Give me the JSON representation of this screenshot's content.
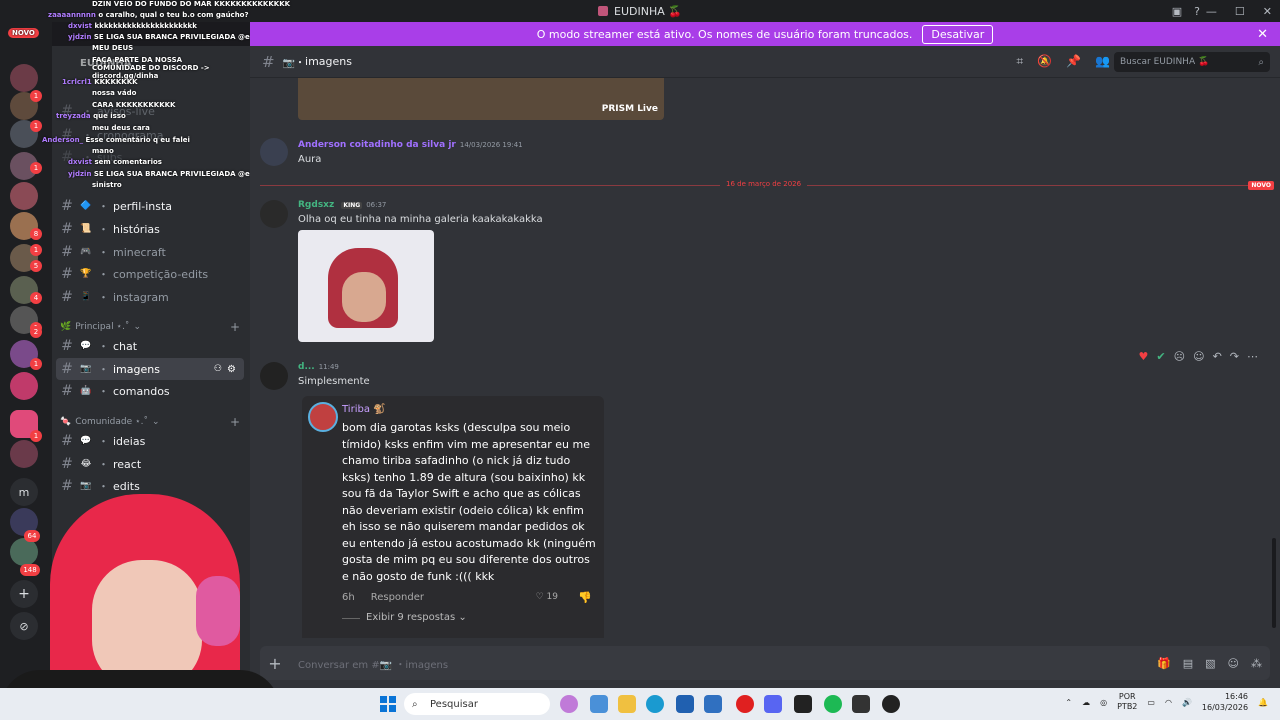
{
  "titlebar": {
    "title": "EUDINHA 🍒"
  },
  "banner": {
    "text": "O modo streamer está ativo. Os nomes de usuário foram truncados.",
    "button": "Desativar"
  },
  "overlay": {
    "novo": "NOVO",
    "lines": [
      {
        "name": "",
        "text": "DZIN VEIO DO FUNDO DO MAR KKKKKKKKKKKKKK"
      },
      {
        "name": "zaaaannnnn",
        "text": "o caralho, qual o teu b.o com gaúcho?"
      },
      {
        "name": "dxvist",
        "text": "kkkkkkkkkkkkkkkkkkkkkk"
      },
      {
        "name": "yjdzin",
        "text": "SE LIGA SUA BRANCA PRIVILEGIADA @eudinha_"
      },
      {
        "name": "",
        "text": "MEU DEUS"
      },
      {
        "name": "",
        "text": "FAÇA PARTE DA NOSSA COMUNIDADE DO DISCORD -> discord.gg/dinha"
      },
      {
        "name": "1crlcrl1",
        "text": "KKKKKKKK"
      },
      {
        "name": "",
        "text": "nossa vádo"
      },
      {
        "name": "",
        "text": "CARA KKKKKKKKKKK"
      },
      {
        "name": "treyzada",
        "text": "que isso"
      },
      {
        "name": "",
        "text": "meu deus cara"
      },
      {
        "name": "Anderson_",
        "text": "Esse comentário q eu falei"
      },
      {
        "name": "",
        "text": "mano"
      },
      {
        "name": "dxvist",
        "text": "sem comentarios"
      },
      {
        "name": "yjdzin",
        "text": "SE LIGA SUA BRANCA PRIVILEGIADA @eudinha_"
      },
      {
        "name": "",
        "text": "sinistro"
      }
    ]
  },
  "sidebar": {
    "server_name": "EUDINHA",
    "faded_channels": [
      "avisos-live",
      "cronograma",
      "subs"
    ],
    "channels_top": [
      {
        "emoji": "🔷",
        "name": "perfil-insta",
        "bright": true
      },
      {
        "emoji": "📜",
        "name": "histórias",
        "bright": true
      },
      {
        "emoji": "🎮",
        "name": "minecraft",
        "bright": false
      },
      {
        "emoji": "🏆",
        "name": "competição-edits",
        "bright": false
      },
      {
        "emoji": "📱",
        "name": "instagram",
        "bright": false
      }
    ],
    "cat_principal": "Principal ⋆.˚",
    "channels_principal": [
      {
        "emoji": "💬",
        "name": "chat",
        "bright": true
      },
      {
        "emoji": "📷",
        "name": "imagens",
        "bright": true,
        "active": true
      },
      {
        "emoji": "🤖",
        "name": "comandos",
        "bright": true
      }
    ],
    "cat_comunidade": "Comunidade ⋆.˚",
    "channels_comunidade": [
      {
        "emoji": "💬",
        "name": "ideias",
        "bright": true
      },
      {
        "emoji": "😂",
        "name": "react",
        "bright": true
      },
      {
        "emoji": "📷",
        "name": "edits",
        "bright": true
      }
    ]
  },
  "servers": {
    "badges": [
      "1",
      "1",
      "1",
      "8",
      "1",
      "5",
      "4",
      "1",
      "2",
      "1",
      "1",
      "64",
      "148"
    ],
    "letter": "m"
  },
  "header": {
    "channel": "imagens",
    "search_placeholder": "Buscar EUDINHA 🍒"
  },
  "messages": {
    "embed_label": "PRISM Live",
    "m1": {
      "author": "Anderson coitadinho da silva jr",
      "time": "14/03/2026 19:41",
      "text": "Aura"
    },
    "divider": {
      "label": "16 de março de 2026",
      "tag": "NOVO"
    },
    "m2": {
      "author": "Rgdsxz",
      "badge": "KING",
      "time": "06:37",
      "text": "Olha oq eu tinha na minha galeria kaakakakakka"
    },
    "m3": {
      "author": "d...",
      "time": "11:49",
      "text": "Simplesmente",
      "card": {
        "author": "Tiriba 🐒",
        "text": "bom dia garotas ksks (desculpa sou meio tímido) ksks enfim vim me apresentar eu me chamo tiriba safadinho (o nick já diz tudo ksks) tenho 1.89 de altura (sou baixinho) kk sou fã da Taylor Swift e acho que as cólicas não deveriam existir (odeio cólica) kk enfim eh isso se não quiserem mandar pedidos ok eu entendo já estou acostumado kk (ninguém gosta de mim pq eu sou diferente dos outros e não gosto de funk :((( kkk",
        "age": "6h",
        "reply": "Responder",
        "likes": "19",
        "replies": "Exibir 9 respostas"
      }
    }
  },
  "input": {
    "placeholder": "Conversar em #📷 ・imagens"
  },
  "taskbar": {
    "search": "Pesquisar",
    "lang1": "POR",
    "lang2": "PTB2",
    "time": "16:46",
    "date": "16/03/2026"
  }
}
